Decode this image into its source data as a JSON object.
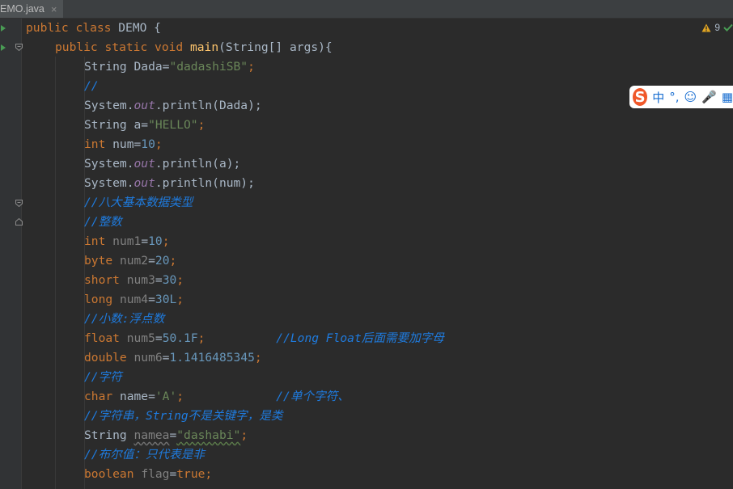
{
  "tab": {
    "filename": "EMO.java",
    "close": "×"
  },
  "inspection": {
    "count": "9"
  },
  "ime": {
    "lang": "中",
    "punct": "°,",
    "emoji": "☺",
    "mic": "🎤",
    "more": "▦"
  },
  "code": {
    "l1": [
      "public",
      "class",
      "DEMO {"
    ],
    "l2": [
      "public",
      "static",
      "void",
      "main",
      "(String[] args){"
    ],
    "l3": [
      "String Dada=",
      "\"dadashiSB\"",
      ";"
    ],
    "l4": "//",
    "l5": [
      "System.",
      "out",
      ".println(Dada);"
    ],
    "l6": [
      "String a=",
      "\"HELLO\"",
      ";"
    ],
    "l7": [
      "int",
      " num=",
      "10",
      ";"
    ],
    "l8": [
      "System.",
      "out",
      ".println(a);"
    ],
    "l9": [
      "System.",
      "out",
      ".println(num);"
    ],
    "l10": "//八大基本数据类型",
    "l11": "//整数",
    "l12": [
      "int",
      "num1",
      "=",
      "10",
      ";"
    ],
    "l13": [
      "byte",
      "num2",
      "=",
      "20",
      ";"
    ],
    "l14": [
      "short",
      "num3",
      "=",
      "30",
      ";"
    ],
    "l15": [
      "long",
      "num4",
      "=",
      "30L",
      ";"
    ],
    "l16": "//小数:浮点数",
    "l17": [
      "float",
      "num5",
      "=",
      "50.1F",
      ";",
      "//Long Float后面需要加字母"
    ],
    "l18": [
      "double",
      "num6",
      "=",
      "1.1416485345",
      ";"
    ],
    "l19": "//字符",
    "l20": [
      "char",
      " name=",
      "'A'",
      ";",
      "//单个字符、"
    ],
    "l21": "//字符串，String不是关键字，是类",
    "l22": [
      "String ",
      "namea",
      "=",
      "\"dashabi\"",
      ";"
    ],
    "l23": "//布尔值：只代表是非",
    "l24": [
      "boolean",
      "flag",
      "=",
      "true",
      ";"
    ]
  }
}
